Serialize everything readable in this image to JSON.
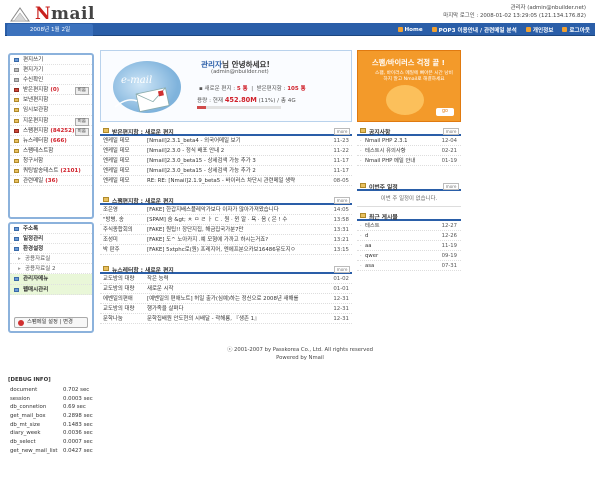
{
  "app": {
    "logo_text": "Nmail",
    "user_line": "관리자 (admin@nbuilder.net)",
    "last_login": "마지막 로그인 : 2008-01-02 13:29:05 (121.134.176.82)"
  },
  "nav": {
    "date": "2008년 1월 2일",
    "menu": [
      "Home",
      "POP3 이용안내 / 관련메일 분석",
      "개인정보",
      "로그아웃"
    ]
  },
  "sidebar": {
    "items": [
      {
        "label": "편지쓰기",
        "count": "",
        "btn": ""
      },
      {
        "label": "편지가기",
        "count": "",
        "btn": ""
      },
      {
        "label": "수신확인",
        "count": "",
        "btn": ""
      },
      {
        "label": "받은편지함",
        "count": "(0)",
        "btn": "비움"
      },
      {
        "label": "보낸편지함",
        "count": "",
        "btn": ""
      },
      {
        "label": "임시보관함",
        "count": "",
        "btn": ""
      },
      {
        "label": "지운편지함",
        "count": "",
        "btn": "비움"
      },
      {
        "label": "스팸편지함",
        "count": "(84252)",
        "btn": "비움"
      },
      {
        "label": "뉴스레터함",
        "count": "(666)",
        "btn": ""
      },
      {
        "label": "스팸테스트함",
        "count": "",
        "btn": ""
      },
      {
        "label": "청구서함",
        "count": "",
        "btn": ""
      },
      {
        "label": "쿼팅발송테스트",
        "count": "(2101)",
        "btn": ""
      },
      {
        "label": "관련메일",
        "count": "(36)",
        "btn": ""
      }
    ],
    "items2": [
      {
        "label": "주소록",
        "kind": "bold"
      },
      {
        "label": "일정관리",
        "kind": "bold"
      },
      {
        "label": "환경설정",
        "kind": "bold"
      },
      {
        "label": "공용자료실",
        "kind": "sub"
      },
      {
        "label": "공용자료실 2",
        "kind": "sub"
      },
      {
        "label": "관리자메뉴",
        "kind": "light"
      },
      {
        "label": "웹매시관리",
        "kind": "light"
      }
    ],
    "spam_setting": "스팸메일 설정 | 변경"
  },
  "welcome": {
    "name": "관리자",
    "greeting_rest": "님 안녕하세요!",
    "email": "(admin@nbuilder.net)",
    "new_label": "새로운 편지 : ",
    "new_count": "5 통",
    "received_label": "받은편지함 : ",
    "received_count": "105 통",
    "quota_label": "용량 : 현재 ",
    "quota_value": "452.80M",
    "quota_rest": " (11%) / 총 4G",
    "quota_fraction": 0.11
  },
  "banner": {
    "title": "스팸/바이러스 걱정 끝 !",
    "text": "스팸, 바이러스 메일에 뼈아픈 시간 낭비하지 말고 Nmail로 해결하세요",
    "go": "go"
  },
  "lists": [
    {
      "title": "받은편지함 : 새로운 편지",
      "more": "more",
      "rows": [
        {
          "from": "엔케일 데모",
          "subject": "[Nmail]2.3.1_beta4 - 외국어메일 보기",
          "date": "11-23"
        },
        {
          "from": "엔케일 데모",
          "subject": "[Nmail]2.3.0 - 정식 배포 안내 2",
          "date": "11-22"
        },
        {
          "from": "엔케일 데모",
          "subject": "[Nmail]2.3.0_beta15 - 상세검색 가능 추가 3",
          "date": "11-17"
        },
        {
          "from": "엔케일 데모",
          "subject": "[Nmail]2.3.0_beta15 - 상세검색 가능 추가 2",
          "date": "11-17"
        },
        {
          "from": "엔케일 데모",
          "subject": "RE: RE: [Nmail]2.1.9_beta5 - 바이러스 차단시 관련메일 생략",
          "date": "08-05"
        }
      ]
    },
    {
      "title": "스팸편지함 : 새로운 편지",
      "more": "more",
      "rows": [
        {
          "from": "조은영",
          "subject": "[FAKE] 한갑지배스플레악가보다 이자가 많아가져왔습니다",
          "date": "14:05"
        },
        {
          "from": "\"방병, 송",
          "subject": "[SPAM] 숨 &gt; ㅊ ㅁ ㄹ ㅏ ㄷ . 원 · 윈 알 · 욕 · 음 ( 은 ! 수",
          "date": "13:58"
        },
        {
          "from": "주식종합회의",
          "subject": "[FAKE] 원팁!! 장단지집, 해금집국가분7만",
          "date": "13:31"
        },
        {
          "from": "조성미",
          "subject": "[FAKE] 도^ 노아카지 .예 모형에 가까고 하시는거죠?",
          "date": "13:21"
        },
        {
          "from": "박 판주",
          "subject": "[FAKE] 5xtphc로(원) 프레지어, 엔에프분으카보16486유도지ㅇ",
          "date": "13:15"
        }
      ]
    },
    {
      "title": "뉴스레터함 : 새로운 편지",
      "more": "more",
      "rows": [
        {
          "from": "교도방의 대량",
          "subject": "작은 능력",
          "date": "01-02"
        },
        {
          "from": "교도방의 대량",
          "subject": "새로운 시작",
          "date": "01-01"
        },
        {
          "from": "에벤일의편애",
          "subject": "[예벤일의 편애노트] 허일 출가(심예)하는 정신으로 2008년 새해를",
          "date": "12-31"
        },
        {
          "from": "교도방의 대량",
          "subject": "행가족을 살펴다",
          "date": "12-31"
        },
        {
          "from": "문학나눔",
          "subject": "문학집배원 안도현의 시배달 - 곽해룡, 『생존 1』",
          "date": "12-31"
        }
      ]
    }
  ],
  "notice": {
    "title": "공지사항",
    "more": "more",
    "rows": [
      {
        "label": "Nmail PHP 2.3.1",
        "date": "12-04"
      },
      {
        "label": "테스트시 유의사항",
        "date": "02-21"
      },
      {
        "label": "Nmail PHP 메일 안내",
        "date": "01-19"
      }
    ]
  },
  "schedule": {
    "title": "이번주 일정",
    "more": "more",
    "empty": "이번 주 일정이 없습니다."
  },
  "recent": {
    "title": "최근 게시물",
    "rows": [
      {
        "label": "테스트",
        "date": "12-27"
      },
      {
        "label": "d",
        "date": "12-26"
      },
      {
        "label": "aa",
        "date": "11-19"
      },
      {
        "label": "qwer",
        "date": "09-19"
      },
      {
        "label": "asa",
        "date": "07-31"
      }
    ]
  },
  "footer": {
    "copyright": "ⓒ 2001-2007 by Passkorea Co., Ltd. All rights reserved",
    "powered": "Powered by Nmail"
  },
  "debug": {
    "title": "[DEBUG INFO]",
    "rows": [
      {
        "k": "document",
        "v": "0.702 sec"
      },
      {
        "k": "session",
        "v": "0.0003 sec"
      },
      {
        "k": "db_connetion",
        "v": "0.69 sec"
      },
      {
        "k": "get_mail_box",
        "v": "0.2898 sec"
      },
      {
        "k": "db_mt_size",
        "v": "0.1483 sec"
      },
      {
        "k": "diary_week",
        "v": "0.0036 sec"
      },
      {
        "k": "db_select",
        "v": "0.0007 sec"
      },
      {
        "k": "get_new_mail_list",
        "v": "0.0427 sec"
      }
    ]
  },
  "colors": {
    "nav_blue": "#2a5ea8",
    "accent_red": "#d0202a",
    "banner_orange": "#f39a2a"
  }
}
